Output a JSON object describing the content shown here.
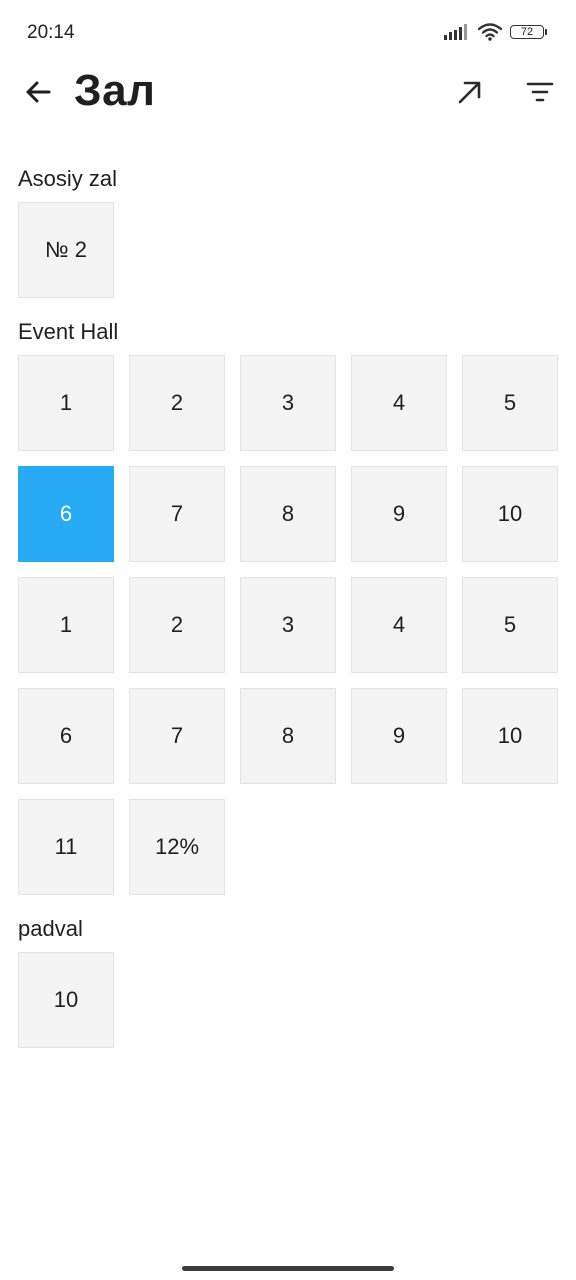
{
  "status_bar": {
    "time": "20:14",
    "battery_level": "72",
    "icons": [
      "signal-icon",
      "wifi-icon",
      "battery-icon"
    ]
  },
  "app_bar": {
    "title": "Зал",
    "back_icon": "arrow-left-icon",
    "actions": [
      "arrow-up-right-icon",
      "filter-icon"
    ]
  },
  "sections": [
    {
      "title": "Asosiy zal",
      "tables": [
        {
          "label": "№ 2",
          "selected": false
        }
      ]
    },
    {
      "title": "Event Hall",
      "tables": [
        {
          "label": "1",
          "selected": false
        },
        {
          "label": "2",
          "selected": false
        },
        {
          "label": "3",
          "selected": false
        },
        {
          "label": "4",
          "selected": false
        },
        {
          "label": "5",
          "selected": false
        },
        {
          "label": "6",
          "selected": true
        },
        {
          "label": "7",
          "selected": false
        },
        {
          "label": "8",
          "selected": false
        },
        {
          "label": "9",
          "selected": false
        },
        {
          "label": "10",
          "selected": false
        },
        {
          "label": "1",
          "selected": false
        },
        {
          "label": "2",
          "selected": false
        },
        {
          "label": "3",
          "selected": false
        },
        {
          "label": "4",
          "selected": false
        },
        {
          "label": "5",
          "selected": false
        },
        {
          "label": "6",
          "selected": false
        },
        {
          "label": "7",
          "selected": false
        },
        {
          "label": "8",
          "selected": false
        },
        {
          "label": "9",
          "selected": false
        },
        {
          "label": "10",
          "selected": false
        },
        {
          "label": "11",
          "selected": false
        },
        {
          "label": "12%",
          "selected": false
        }
      ]
    },
    {
      "title": "padval",
      "tables": [
        {
          "label": "10",
          "selected": false
        }
      ]
    }
  ],
  "colors": {
    "selected_tile": "#29aaf5",
    "tile_background": "#f4f4f4",
    "tile_border": "#e3e3e3",
    "text": "#1f1f1f"
  }
}
